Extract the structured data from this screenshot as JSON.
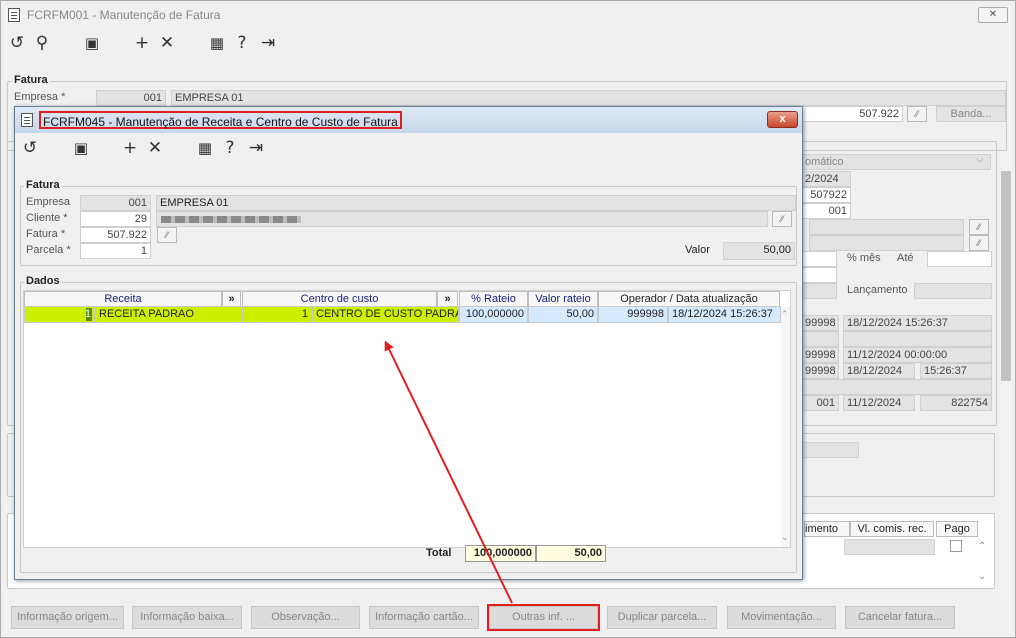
{
  "main": {
    "title": "FCRFM001 - Manutenção de Fatura",
    "fatura_label": "Fatura",
    "empresa_label": "Empresa *",
    "empresa_code": "001",
    "empresa_name": "EMPRESA 01",
    "fatura_num": "507.922",
    "banda_label": "Banda...",
    "right": {
      "automatico": "omático",
      "date": "2/2024",
      "num": "507922",
      "code": "001",
      "pct_mes_label": "% mês",
      "ate_label": "Até",
      "lancamento_label": "Lançamento",
      "r1_a": "99998",
      "r1_b": "18/12/2024 15:26:37",
      "r2_a": "99998",
      "r2_b": "11/12/2024 00:00:00",
      "r3_a": "99998",
      "r3_b": "18/12/2024",
      "r3_c": "15:26:37",
      "r4_a": "001",
      "r4_b": "11/12/2024",
      "r4_c": "822754"
    },
    "lower_headers": [
      "imento",
      "Vl. comis. rec.",
      "Pago"
    ],
    "bottom_buttons": [
      "Informação origem...",
      "Informação baixa...",
      "Observação...",
      "Informação cartão...",
      "Outras inf. ...",
      "Duplicar parcela...",
      "Movimentação...",
      "Cancelar fatura..."
    ]
  },
  "modal": {
    "title": "FCRFM045 - Manutenção de Receita e Centro de Custo de Fatura",
    "close": "x",
    "fatura_group": "Fatura",
    "empresa_label": "Empresa",
    "empresa_code": "001",
    "empresa_name": "EMPRESA 01",
    "cliente_label": "Cliente *",
    "cliente_code": "29",
    "fatura_label": "Fatura *",
    "fatura_num": "507.922",
    "parcela_label": "Parcela *",
    "parcela_num": "1",
    "valor_label": "Valor",
    "valor": "50,00",
    "dados_group": "Dados",
    "headers": {
      "receita": "Receita",
      "centro": "Centro de custo",
      "rateio": "% Rateio",
      "valor_rateio": "Valor rateio",
      "operador": "Operador / Data atualização",
      "expand": "»"
    },
    "row": {
      "receita_code": "1",
      "receita_name": "RECEITA PADRAO",
      "centro_code": "1",
      "centro_name": "CENTRO DE CUSTO PADRAO",
      "rateio": "100,000000",
      "valor_rateio": "50,00",
      "operador": "999998",
      "data": "18/12/2024 15:26:37"
    },
    "total_label": "Total",
    "total_rateio": "100,000000",
    "total_valor": "50,00"
  },
  "colors": {
    "highlight": "#e02020",
    "row_lime": "#ccf000",
    "row_blue": "#d5eafd"
  }
}
